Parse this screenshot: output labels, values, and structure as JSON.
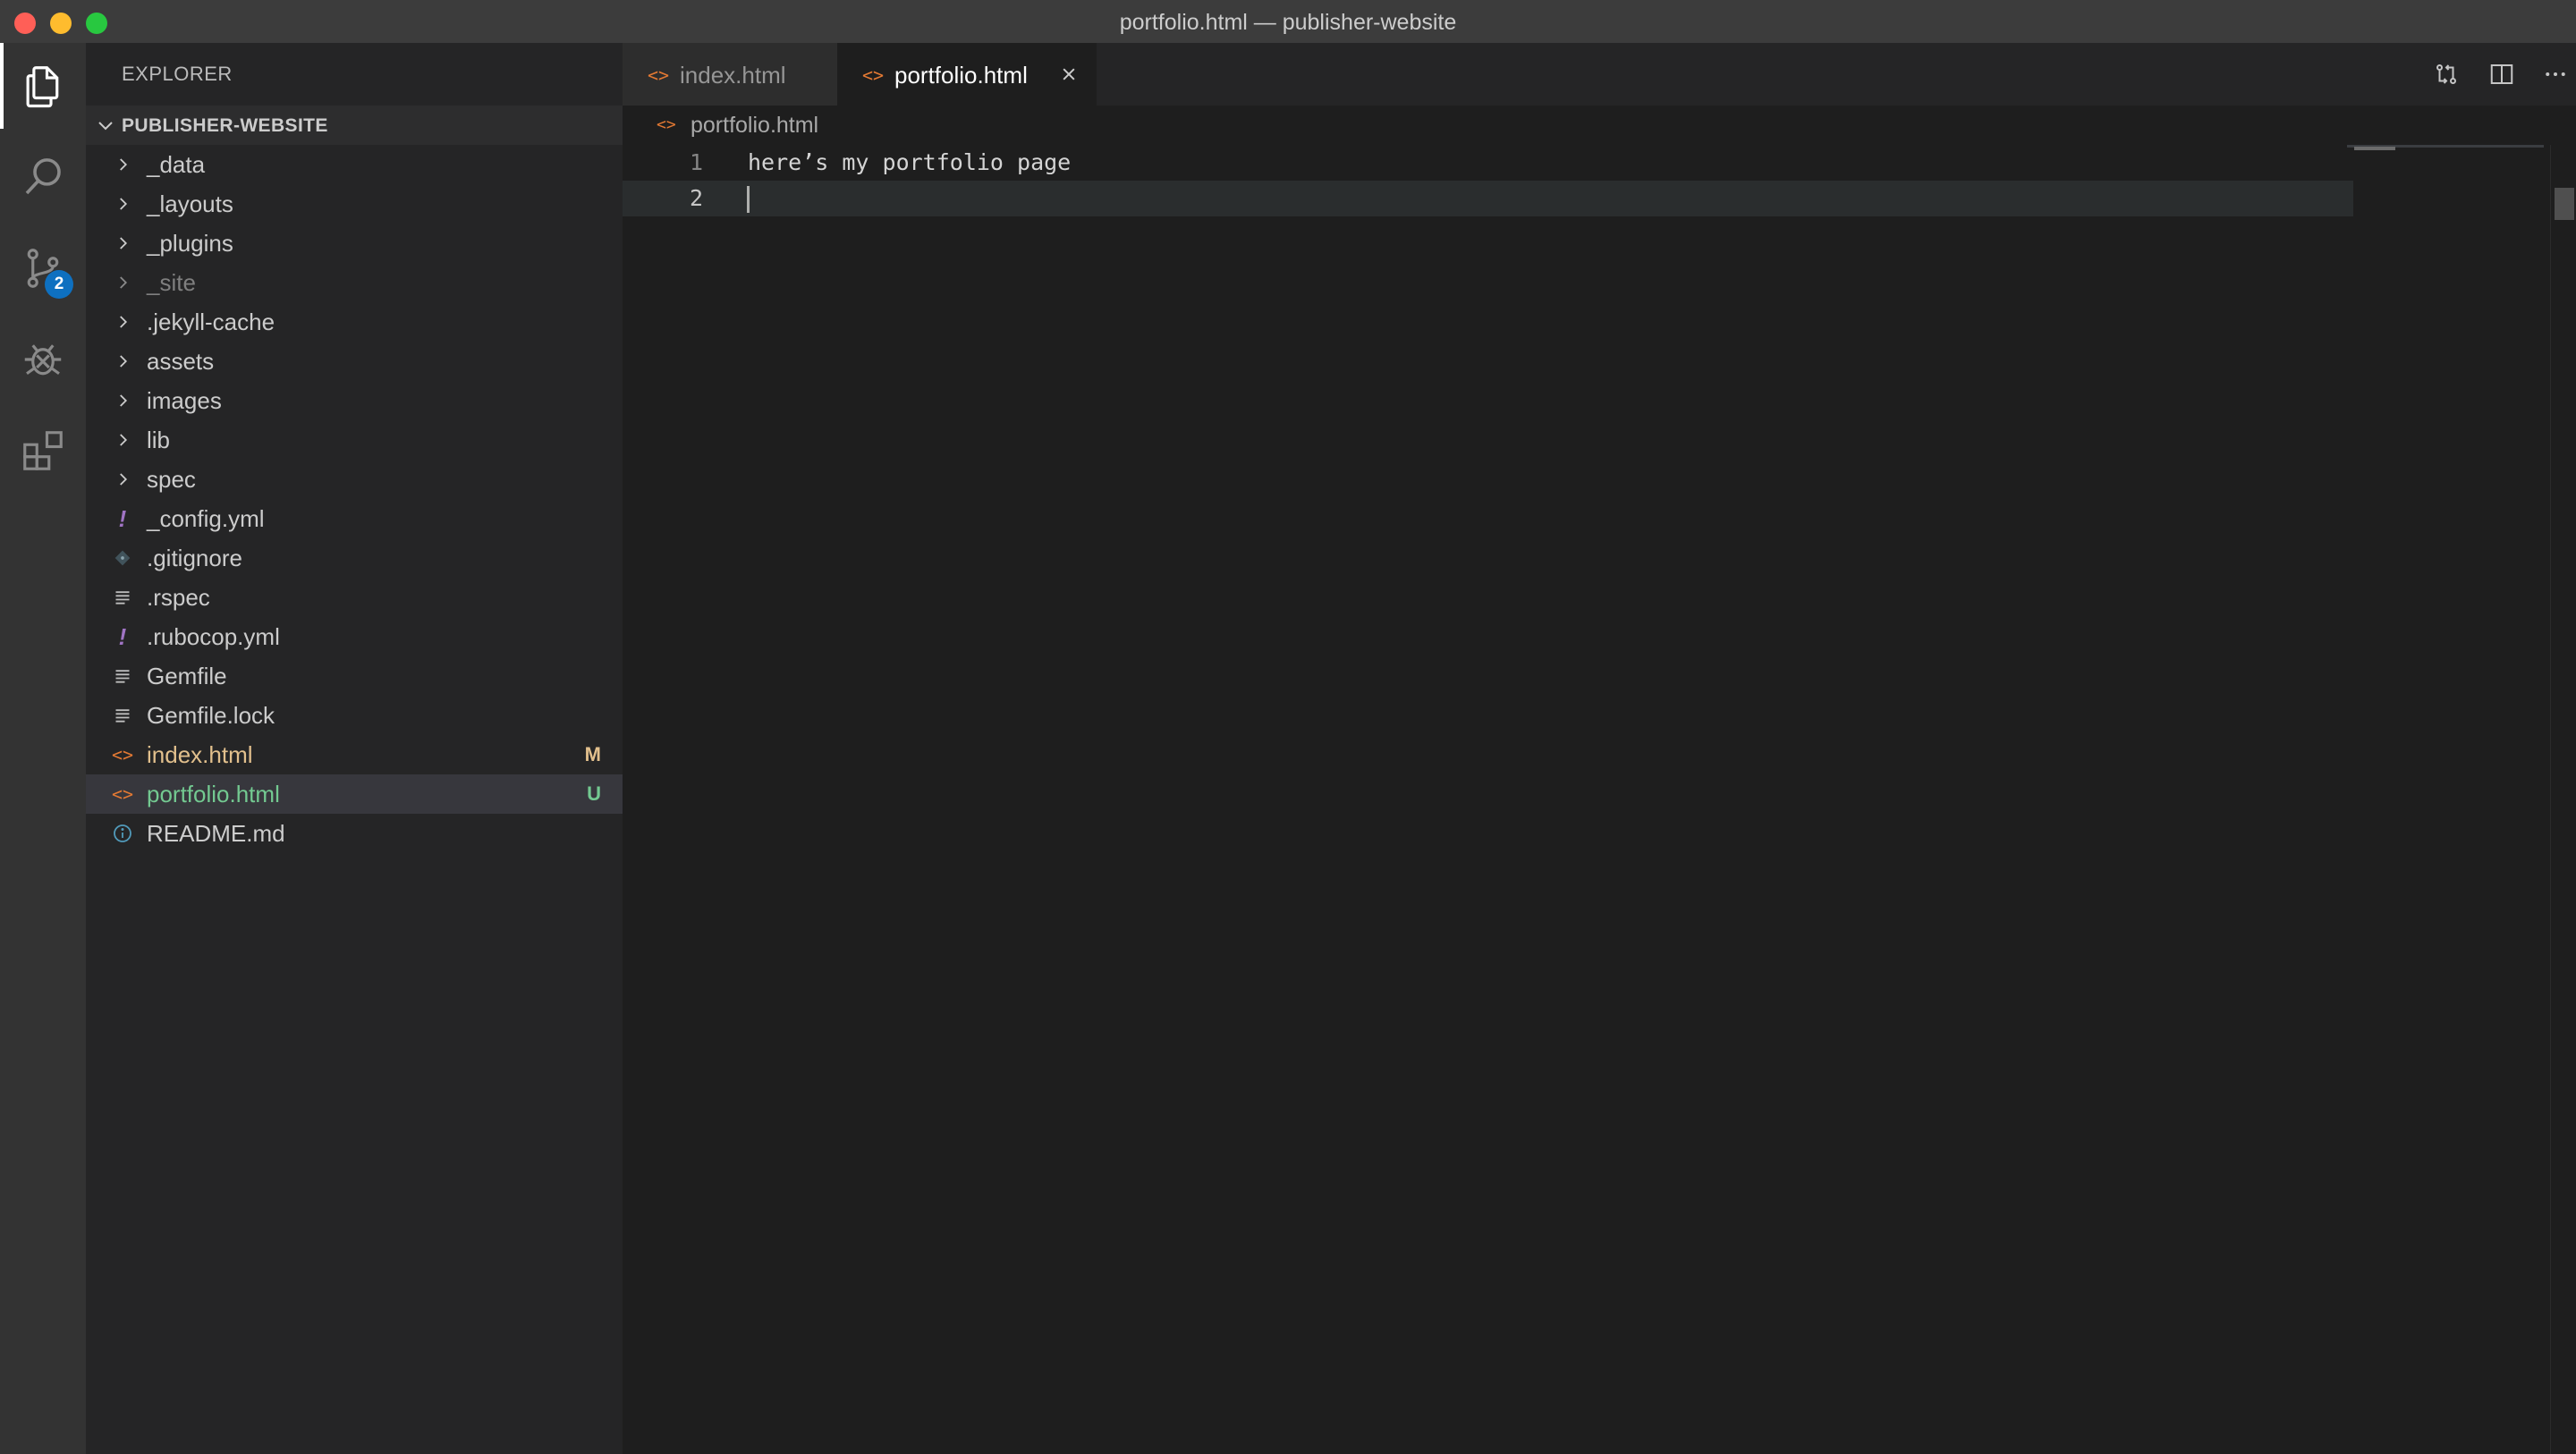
{
  "window": {
    "title": "portfolio.html — publisher-website"
  },
  "activity_bar": {
    "items": [
      {
        "name": "explorer",
        "icon": "files-icon"
      },
      {
        "name": "search",
        "icon": "search-icon"
      },
      {
        "name": "source-control",
        "icon": "source-control-icon",
        "badge": "2"
      },
      {
        "name": "debug",
        "icon": "debug-icon"
      },
      {
        "name": "extensions",
        "icon": "extensions-icon"
      }
    ]
  },
  "sidebar": {
    "header": "EXPLORER",
    "folder": "PUBLISHER-WEBSITE",
    "items": [
      {
        "label": "_data",
        "kind": "folder"
      },
      {
        "label": "_layouts",
        "kind": "folder"
      },
      {
        "label": "_plugins",
        "kind": "folder"
      },
      {
        "label": "_site",
        "kind": "folder",
        "dim": true
      },
      {
        "label": ".jekyll-cache",
        "kind": "folder"
      },
      {
        "label": "assets",
        "kind": "folder"
      },
      {
        "label": "images",
        "kind": "folder"
      },
      {
        "label": "lib",
        "kind": "folder"
      },
      {
        "label": "spec",
        "kind": "folder"
      },
      {
        "label": "_config.yml",
        "kind": "yaml"
      },
      {
        "label": ".gitignore",
        "kind": "git"
      },
      {
        "label": ".rspec",
        "kind": "text"
      },
      {
        "label": ".rubocop.yml",
        "kind": "yaml"
      },
      {
        "label": "Gemfile",
        "kind": "text"
      },
      {
        "label": "Gemfile.lock",
        "kind": "text"
      },
      {
        "label": "index.html",
        "kind": "html",
        "status": "M"
      },
      {
        "label": "portfolio.html",
        "kind": "html",
        "status": "U",
        "selected": true
      },
      {
        "label": "README.md",
        "kind": "info"
      }
    ]
  },
  "editor": {
    "tabs": [
      {
        "label": "index.html",
        "active": false
      },
      {
        "label": "portfolio.html",
        "active": true
      }
    ],
    "breadcrumb": "portfolio.html",
    "lines": [
      {
        "number": "1",
        "text": "here’s my portfolio page"
      },
      {
        "number": "2",
        "text": ""
      }
    ]
  },
  "colors": {
    "accent": "#0e70c0",
    "modified": "#e2c08d",
    "untracked": "#73c991",
    "html_icon": "#e37933",
    "yaml_icon": "#a074c4"
  }
}
